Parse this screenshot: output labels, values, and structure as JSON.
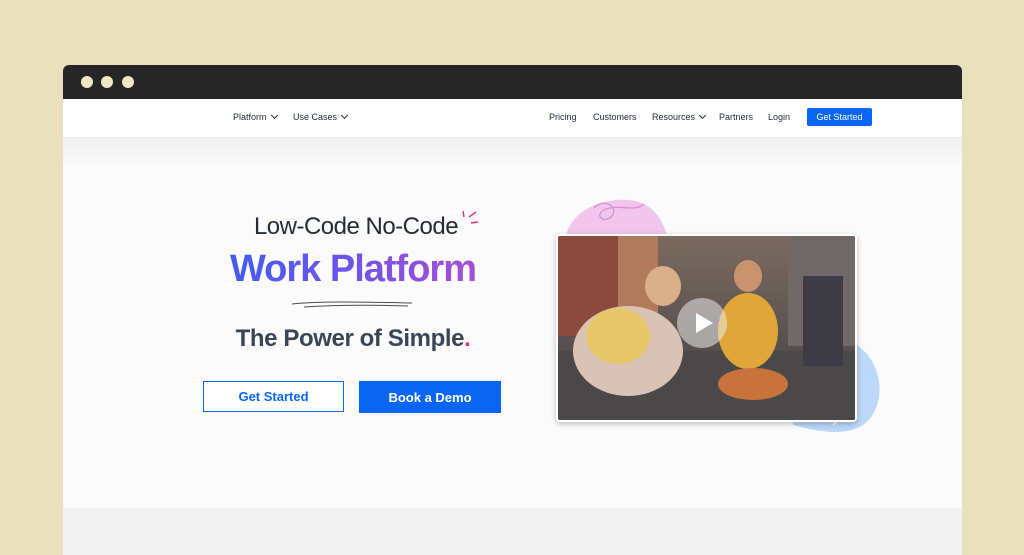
{
  "window": {
    "controls": [
      "close",
      "minimize",
      "maximize"
    ]
  },
  "nav": {
    "left": [
      {
        "label": "Platform",
        "has_menu": true
      },
      {
        "label": "Use Cases",
        "has_menu": true
      }
    ],
    "right": [
      {
        "label": "Pricing"
      },
      {
        "label": "Customers"
      },
      {
        "label": "Resources",
        "has_menu": true
      },
      {
        "label": "Partners"
      },
      {
        "label": "Login"
      }
    ],
    "cta": "Get Started"
  },
  "hero": {
    "eyebrow": "Low-Code No-Code",
    "headline": "Work Platform",
    "tagline": "The Power of Simple",
    "tagline_punct": ".",
    "primary_button": "Get Started",
    "secondary_button": "Book a Demo",
    "video": {
      "icon": "play-icon"
    }
  },
  "colors": {
    "accent": "#0a66f2",
    "gradient_start": "#3d5ef0",
    "gradient_end": "#b04ed1",
    "tagline_dot": "#e3307f",
    "page_background": "#ebe0bd"
  }
}
